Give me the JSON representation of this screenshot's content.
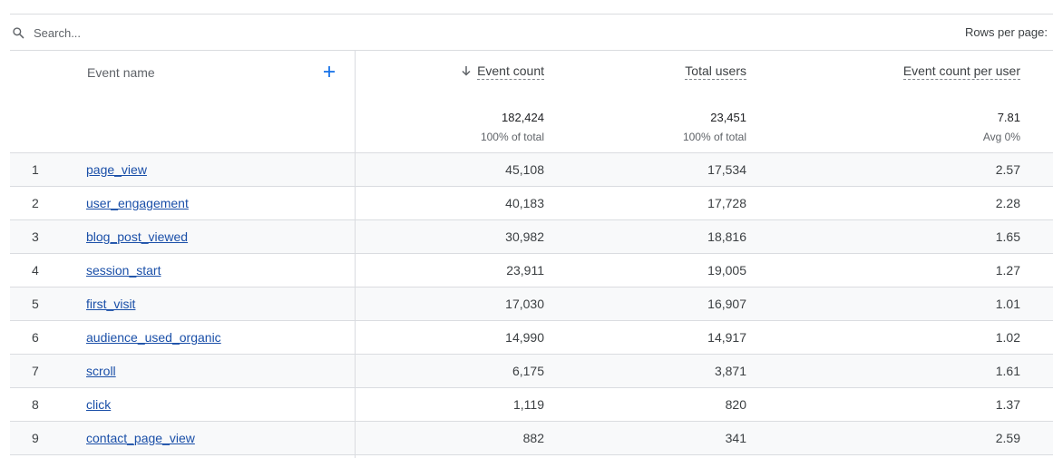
{
  "search": {
    "placeholder": "Search..."
  },
  "toolbar": {
    "rows_per_page_label": "Rows per page:"
  },
  "table": {
    "columns": {
      "event_name": "Event name",
      "event_count": "Event count",
      "total_users": "Total users",
      "event_count_per_user": "Event count per user"
    },
    "sort": {
      "column": "event_count",
      "direction": "descending",
      "icon": "arrow-down-icon"
    },
    "add_dimension_icon": "plus-icon",
    "totals": {
      "event_count": "182,424",
      "event_count_sub": "100% of total",
      "total_users": "23,451",
      "total_users_sub": "100% of total",
      "event_count_per_user": "7.81",
      "event_count_per_user_sub": "Avg 0%"
    },
    "rows": [
      {
        "index": "1",
        "name": "page_view",
        "event_count": "45,108",
        "total_users": "17,534",
        "per_user": "2.57"
      },
      {
        "index": "2",
        "name": "user_engagement",
        "event_count": "40,183",
        "total_users": "17,728",
        "per_user": "2.28"
      },
      {
        "index": "3",
        "name": "blog_post_viewed",
        "event_count": "30,982",
        "total_users": "18,816",
        "per_user": "1.65"
      },
      {
        "index": "4",
        "name": "session_start",
        "event_count": "23,911",
        "total_users": "19,005",
        "per_user": "1.27"
      },
      {
        "index": "5",
        "name": "first_visit",
        "event_count": "17,030",
        "total_users": "16,907",
        "per_user": "1.01"
      },
      {
        "index": "6",
        "name": "audience_used_organic",
        "event_count": "14,990",
        "total_users": "14,917",
        "per_user": "1.02"
      },
      {
        "index": "7",
        "name": "scroll",
        "event_count": "6,175",
        "total_users": "3,871",
        "per_user": "1.61"
      },
      {
        "index": "8",
        "name": "click",
        "event_count": "1,119",
        "total_users": "820",
        "per_user": "1.37"
      },
      {
        "index": "9",
        "name": "contact_page_view",
        "event_count": "882",
        "total_users": "341",
        "per_user": "2.59"
      }
    ]
  },
  "colors": {
    "link": "#1a4fa8",
    "accent": "#1a73e8",
    "border": "#dadce0",
    "row_alt": "#f8f9fa"
  }
}
